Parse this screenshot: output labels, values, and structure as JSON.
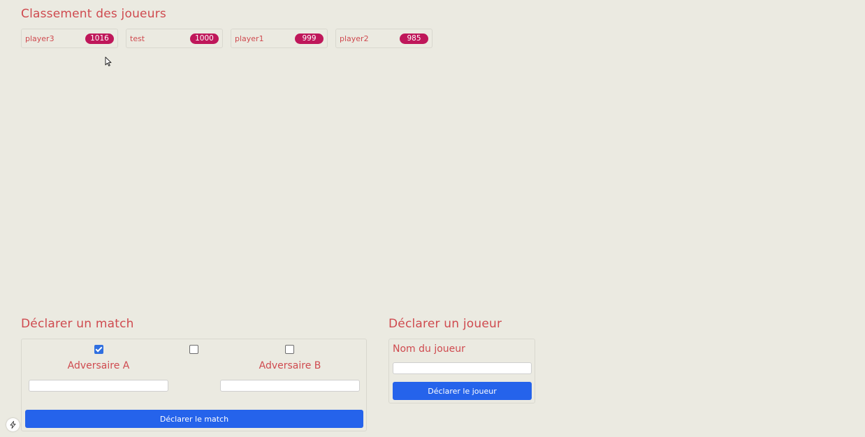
{
  "ranking": {
    "title": "Classement des joueurs",
    "players": [
      {
        "name": "player3",
        "score": "1016"
      },
      {
        "name": "test",
        "score": "1000"
      },
      {
        "name": "player1",
        "score": "999"
      },
      {
        "name": "player2",
        "score": "985"
      }
    ]
  },
  "match_form": {
    "title": "Déclarer un match",
    "checkboxes": {
      "a_checked": true,
      "middle_checked": false,
      "b_checked": false
    },
    "opponent_a_label": "Adversaire A",
    "opponent_b_label": "Adversaire B",
    "opponent_a_value": "",
    "opponent_b_value": "",
    "submit_label": "Déclarer le match"
  },
  "player_form": {
    "title": "Déclarer un joueur",
    "name_label": "Nom du joueur",
    "name_value": "",
    "submit_label": "Déclarer le joueur"
  },
  "colors": {
    "background": "#ebeae1",
    "heading": "#cf4a4f",
    "score_badge": "#bf175a",
    "button": "#2563eb"
  },
  "icons": {
    "cursor": "mouse-pointer-icon",
    "badge": "bolt-icon"
  }
}
